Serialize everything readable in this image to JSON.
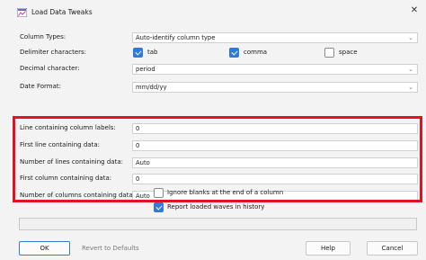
{
  "window": {
    "title": "Load Data Tweaks",
    "close_glyph": "✕"
  },
  "rows": {
    "column_types": {
      "label": "Column Types:",
      "value": "Auto-identify column type"
    },
    "delimiter": {
      "label": "Delimiter characters:",
      "options": [
        {
          "label": "tab",
          "checked": true
        },
        {
          "label": "comma",
          "checked": true
        },
        {
          "label": "space",
          "checked": false
        }
      ]
    },
    "decimal": {
      "label": "Decimal character:",
      "value": "period"
    },
    "date_format": {
      "label": "Date Format:",
      "value": "mm/dd/yy"
    },
    "label_line": {
      "label": "Line containing column labels:",
      "value": "0"
    },
    "first_line": {
      "label": "First line containing data:",
      "value": "0"
    },
    "num_lines": {
      "label": "Number of lines containing data:",
      "value": "Auto"
    },
    "first_col": {
      "label": "First column containing data:",
      "value": "0"
    },
    "num_cols": {
      "label": "Number of columns containing data:",
      "value": "Auto"
    }
  },
  "options": {
    "ignore_blanks": {
      "label": "Ignore blanks at the end of a column",
      "checked": false
    },
    "report_waves": {
      "label": "Report loaded waves in history",
      "checked": true
    }
  },
  "buttons": {
    "ok": "OK",
    "revert": "Revert to Defaults",
    "help": "Help",
    "cancel": "Cancel"
  },
  "colors": {
    "accent": "#2f7bd6",
    "highlight": "#e0141e"
  },
  "icons": {
    "app": "load-data-icon",
    "chevron": "chevron-down-icon"
  }
}
